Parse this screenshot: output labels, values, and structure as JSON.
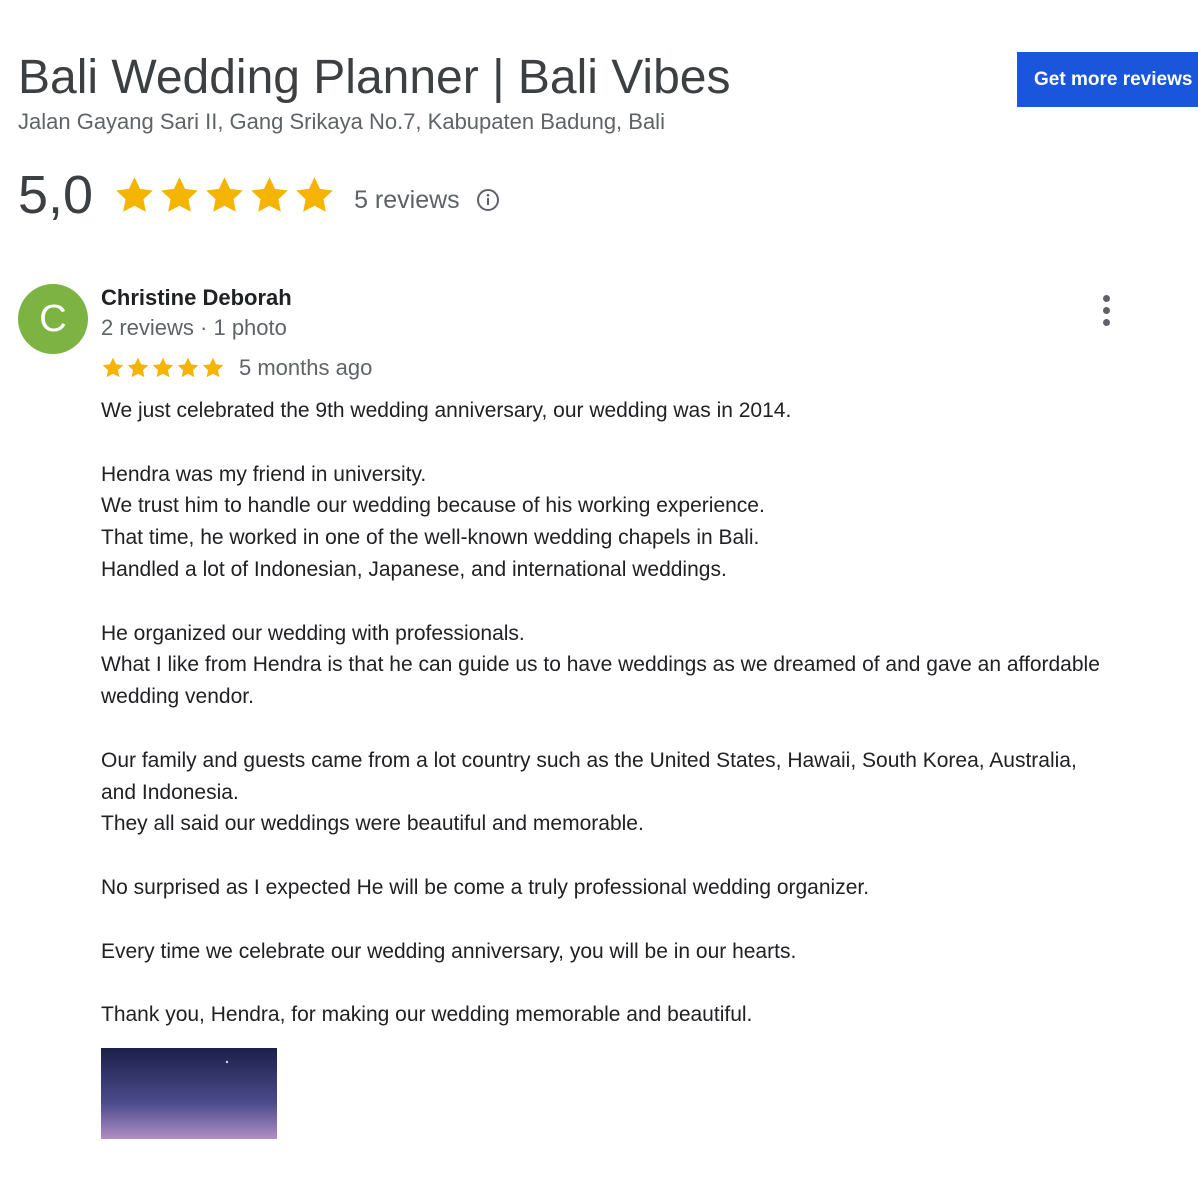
{
  "business": {
    "name": "Bali Wedding Planner | Bali Vibes",
    "address": "Jalan Gayang Sari II, Gang Srikaya No.7, Kabupaten Badung, Bali",
    "cta_label": "Get more reviews",
    "cta_color": "#1a56db"
  },
  "summary": {
    "average": "5,0",
    "stars": 5,
    "star_color": "#f4b400",
    "count_label": "5 reviews",
    "info_icon": "info-circle-icon"
  },
  "review": {
    "avatar_letter": "C",
    "avatar_color": "#7cb342",
    "author": "Christine Deborah",
    "meta": "2 reviews · 1 photo",
    "rating": 5,
    "age": "5 months ago",
    "menu_icon": "more-vert-icon",
    "paragraphs": [
      [
        "We just celebrated the 9th wedding anniversary, our wedding was in 2014."
      ],
      [
        "Hendra was my friend in university.",
        "We trust him to handle our wedding because of his working experience.",
        "That time, he worked in one of the well-known wedding chapels in Bali.",
        "Handled a lot of Indonesian, Japanese, and international weddings."
      ],
      [
        "He organized our wedding with professionals.",
        "What I like from Hendra is that he can guide us to have weddings as we dreamed of and gave an affordable wedding vendor."
      ],
      [
        "Our family and guests came from a lot country such as the United States, Hawaii, South Korea, Australia, and Indonesia.",
        "They all said our weddings were beautiful and memorable."
      ],
      [
        "No surprised as I expected He will be come a truly professional wedding organizer."
      ],
      [
        "Every time we celebrate our wedding anniversary, you will be in our hearts."
      ],
      [
        "Thank you, Hendra, for making our wedding memorable and beautiful."
      ]
    ],
    "photo_colors": [
      "#1c1f4a",
      "#4b4a8a",
      "#b08fc4"
    ]
  }
}
